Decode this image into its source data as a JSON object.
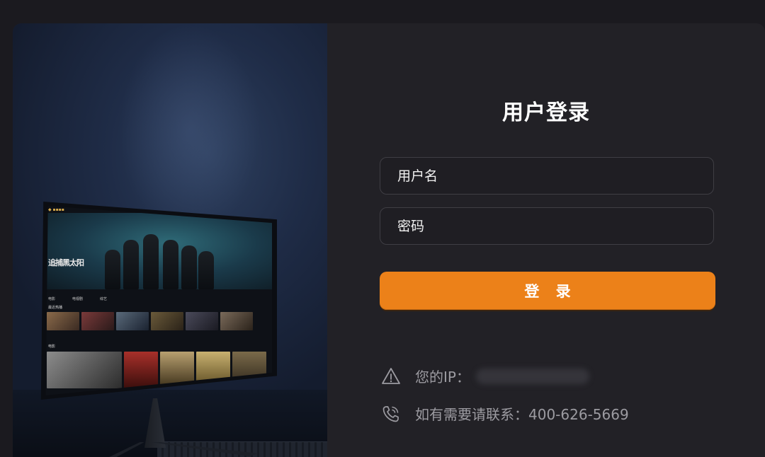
{
  "login": {
    "title": "用户登录",
    "username_placeholder": "用户名",
    "password_placeholder": "密码",
    "submit_label": "登 录"
  },
  "info": {
    "ip_label": "您的IP：",
    "contact_label": "如有需要请联系：400-626-5669",
    "icons": [
      "warning-icon",
      "phone-icon"
    ]
  },
  "monitor_screen": {
    "hero_title": "追捕黑太阳",
    "nav": [
      "电影",
      "电视剧",
      "综艺"
    ],
    "rows": [
      "最近热播",
      "电影"
    ]
  },
  "colors": {
    "background": "#1b1a1f",
    "panel": "#222126",
    "accent": "#ec8119",
    "muted_text": "#9c9ba1"
  }
}
